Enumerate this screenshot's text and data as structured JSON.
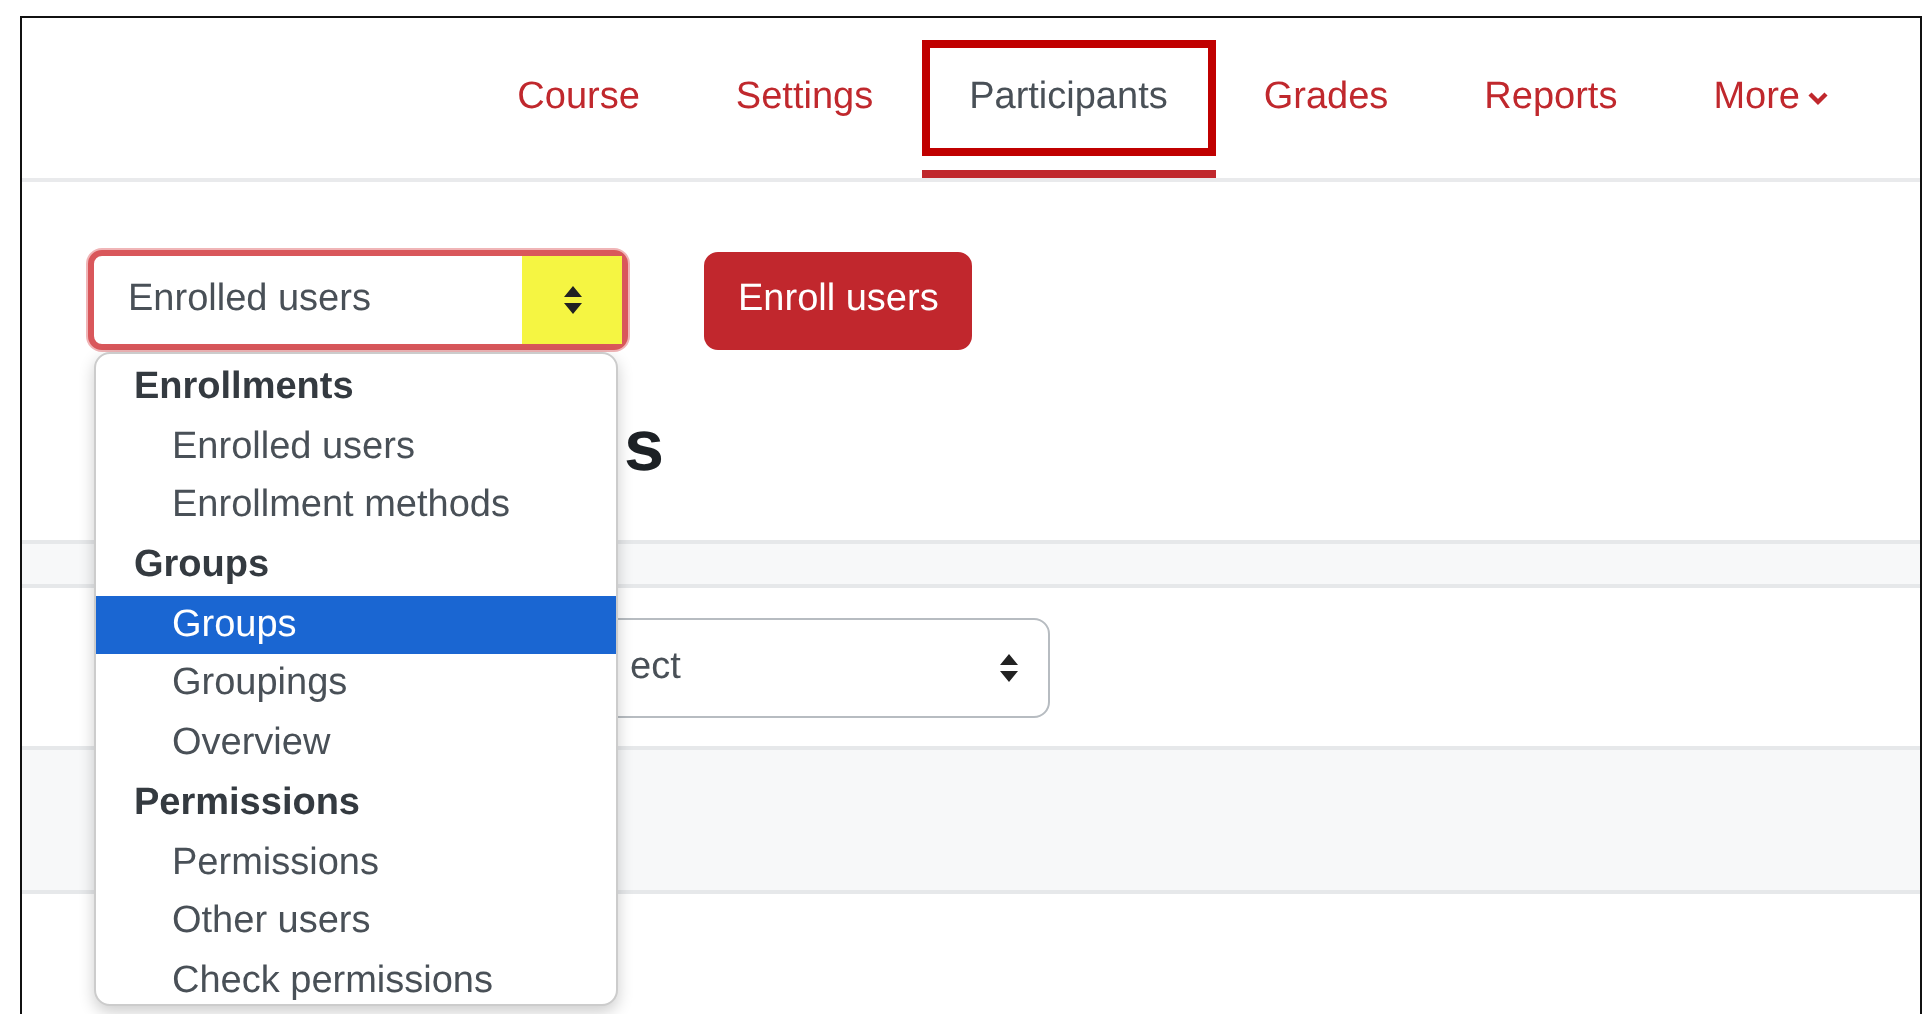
{
  "nav": {
    "tabs": [
      {
        "label": "Course",
        "selected": false,
        "highlighted": false,
        "kind": "link"
      },
      {
        "label": "Settings",
        "selected": false,
        "highlighted": false,
        "kind": "link"
      },
      {
        "label": "Participants",
        "selected": true,
        "highlighted": true,
        "kind": "link"
      },
      {
        "label": "Grades",
        "selected": false,
        "highlighted": false,
        "kind": "link"
      },
      {
        "label": "Reports",
        "selected": false,
        "highlighted": false,
        "kind": "link"
      },
      {
        "label": "More",
        "selected": false,
        "highlighted": false,
        "kind": "menu"
      }
    ]
  },
  "navigation_select": {
    "value": "Enrolled users",
    "highlighted": true,
    "expanded": true,
    "groups": [
      {
        "label": "Enrollments",
        "options": [
          {
            "label": "Enrolled users",
            "selected": false
          },
          {
            "label": "Enrollment methods",
            "selected": false
          }
        ]
      },
      {
        "label": "Groups",
        "options": [
          {
            "label": "Groups",
            "selected": true
          },
          {
            "label": "Groupings",
            "selected": false
          },
          {
            "label": "Overview",
            "selected": false
          }
        ]
      },
      {
        "label": "Permissions",
        "options": [
          {
            "label": "Permissions",
            "selected": false
          },
          {
            "label": "Other users",
            "selected": false
          },
          {
            "label": "Check permissions",
            "selected": false
          }
        ]
      }
    ]
  },
  "enroll_button": "Enroll users",
  "heading": "s",
  "filter_select": {
    "value": "ect"
  }
}
